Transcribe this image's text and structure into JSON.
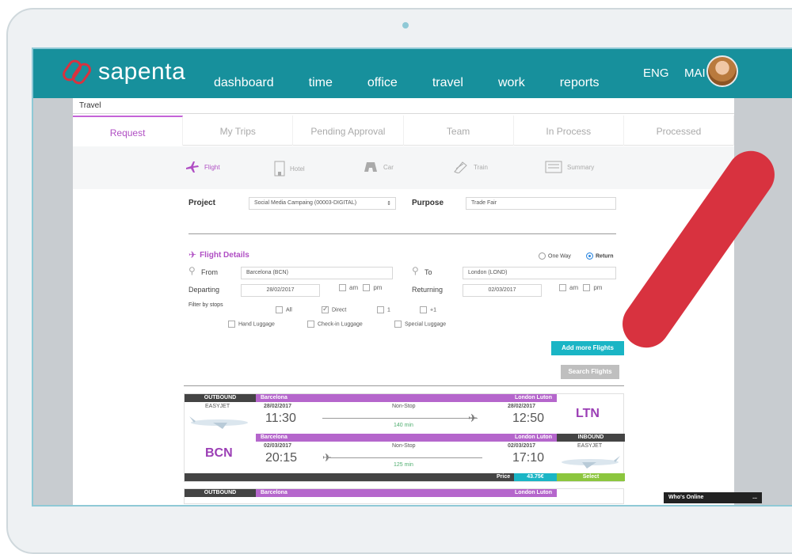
{
  "app": {
    "logo": "sapenta",
    "lang": "ENG",
    "user": "MAI"
  },
  "nav": [
    "dashboard",
    "time",
    "office",
    "travel",
    "work",
    "reports"
  ],
  "breadcrumb": "Travel",
  "tabs": [
    "Request",
    "My Trips",
    "Pending Approval",
    "Team",
    "In Process",
    "Processed"
  ],
  "subtabs": [
    "Flight",
    "Hotel",
    "Car",
    "Train",
    "Summary"
  ],
  "form": {
    "project_label": "Project",
    "project_value": "Social Media Campaing (00003-DIGITAL)",
    "purpose_label": "Purpose",
    "purpose_value": "Trade Fair",
    "flight_details": "Flight Details",
    "one_way": "One Way",
    "return": "Return",
    "from_label": "From",
    "from_value": "Barcelona (BCN)",
    "to_label": "To",
    "to_value": "London (LOND)",
    "departing_label": "Departing",
    "departing_value": "28/02/2017",
    "returning_label": "Returning",
    "returning_value": "02/03/2017",
    "am": "am",
    "pm": "pm",
    "filter_label": "Filter by stops",
    "stops": [
      "All",
      "Direct",
      "1",
      "+1"
    ],
    "luggage": [
      "Hand Luggage",
      "Check-in Luggage",
      "Special Luggage"
    ],
    "add_more": "Add more Flights",
    "search": "Search Flights"
  },
  "result": {
    "outbound_tag": "OUTBOUND",
    "outbound_carrier": "EASYJET",
    "out_from": "Barcelona",
    "out_to": "London Luton",
    "out_date": "28/02/2017",
    "out_dep": "11:30",
    "out_stop": "Non-Stop",
    "out_dur": "140 min",
    "out_arr_date": "28/02/2017",
    "out_arr": "12:50",
    "dest_code": "LTN",
    "in_from": "Barcelona",
    "in_to": "London Luton",
    "inbound_tag": "INBOUND",
    "inbound_carrier": "EASYJET",
    "origin_code": "BCN",
    "in_date": "02/03/2017",
    "in_dep": "20:15",
    "in_stop": "Non-Stop",
    "in_dur": "125 min",
    "in_arr_date": "02/03/2017",
    "in_arr": "17:10",
    "price_label": "Price",
    "price": "43.75€",
    "select": "Select",
    "next_out_tag": "OUTBOUND",
    "next_from": "Barcelona",
    "next_to": "London Luton"
  },
  "online": "Who's Online",
  "online_dash": "..."
}
